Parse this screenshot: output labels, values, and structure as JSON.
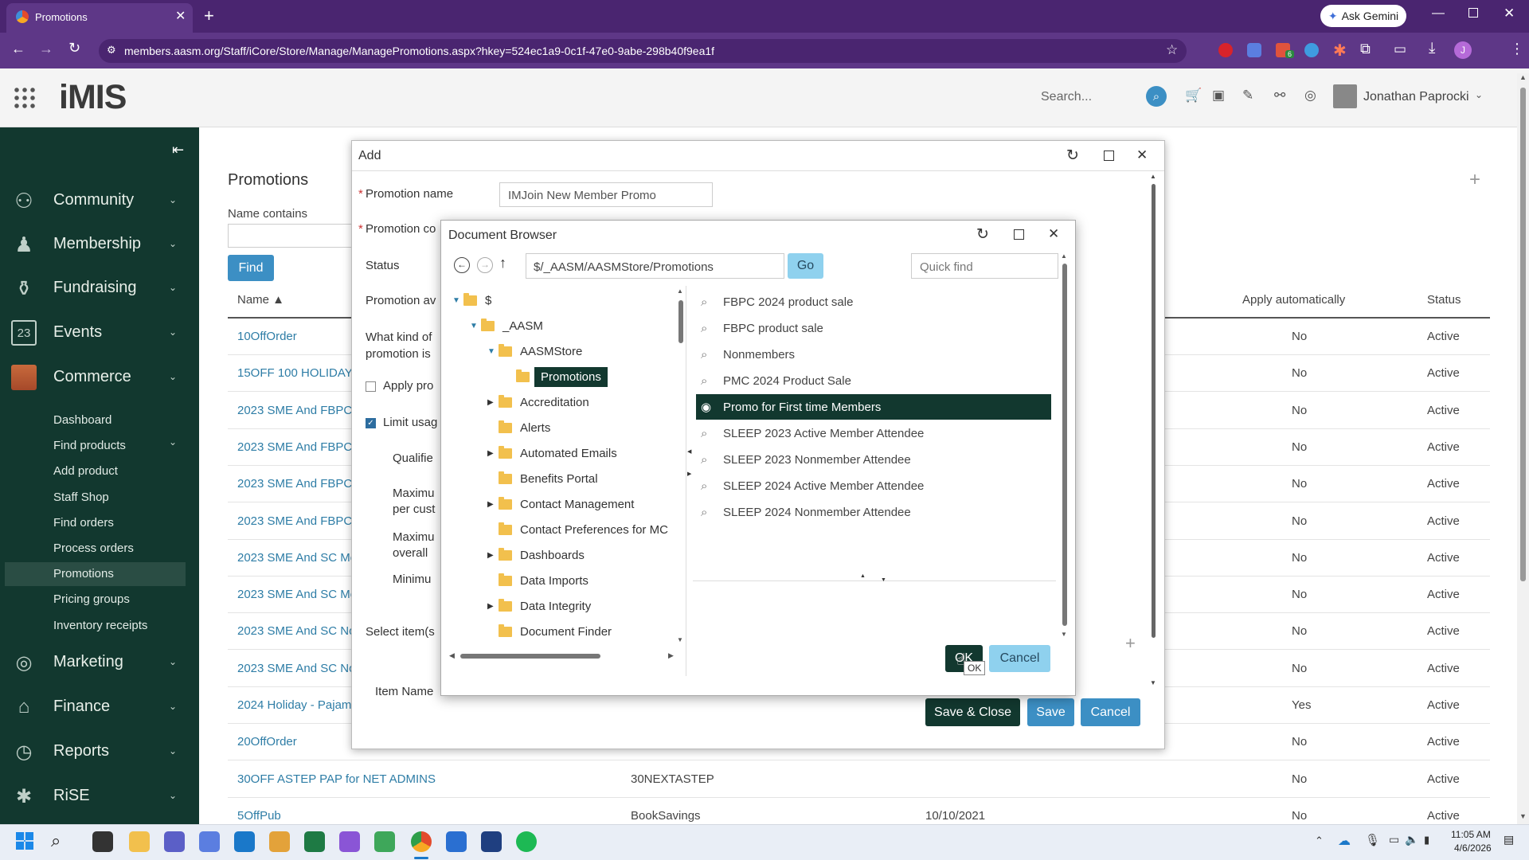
{
  "browser": {
    "tab_title": "Promotions",
    "url": "members.aasm.org/Staff/iCore/Store/Manage/ManagePromotions.aspx?hkey=524ec1a9-0c1f-47e0-9abe-298b40f9ea1f",
    "ask_gemini": "Ask Gemini",
    "extension_badge": "6",
    "profile_initial": "J"
  },
  "app": {
    "logo": "iMIS",
    "search_placeholder": "Search...",
    "user_name": "Jonathan Paprocki"
  },
  "sidebar": {
    "main_items": [
      {
        "label": "Community",
        "icon": "community-icon"
      },
      {
        "label": "Membership",
        "icon": "membership-icon"
      },
      {
        "label": "Fundraising",
        "icon": "fundraising-icon"
      },
      {
        "label": "Events",
        "icon": "calendar-icon",
        "day": "23"
      },
      {
        "label": "Commerce",
        "icon": "commerce-icon"
      }
    ],
    "commerce_sub": [
      "Dashboard",
      "Find products",
      "Add product",
      "Staff Shop",
      "Find orders",
      "Process orders",
      "Promotions",
      "Pricing groups",
      "Inventory receipts"
    ],
    "active_sub": "Promotions",
    "lower_items": [
      {
        "label": "Marketing",
        "icon": "marketing-icon"
      },
      {
        "label": "Finance",
        "icon": "finance-icon"
      },
      {
        "label": "Reports",
        "icon": "reports-icon"
      },
      {
        "label": "RiSE",
        "icon": "rise-icon"
      }
    ]
  },
  "page": {
    "title": "Promotions",
    "filter_label": "Name contains",
    "find_button": "Find",
    "columns": {
      "name": "Name ▲",
      "apply": "Apply automatically",
      "status": "Status"
    },
    "rows": [
      {
        "name": "10OffOrder",
        "code": "",
        "date": "",
        "apply": "No",
        "status": "Active"
      },
      {
        "name": "15OFF 100 HOLIDAY",
        "code": "",
        "date": "",
        "apply": "No",
        "status": "Active"
      },
      {
        "name": "2023 SME And FBPC",
        "code": "",
        "date": "",
        "apply": "No",
        "status": "Active"
      },
      {
        "name": "2023 SME And FBPC",
        "code": "",
        "date": "",
        "apply": "No",
        "status": "Active"
      },
      {
        "name": "2023 SME And FBPC",
        "code": "",
        "date": "",
        "apply": "No",
        "status": "Active"
      },
      {
        "name": "2023 SME And FBPC",
        "code": "",
        "date": "",
        "apply": "No",
        "status": "Active"
      },
      {
        "name": "2023 SME And SC Me",
        "code": "",
        "date": "",
        "apply": "No",
        "status": "Active"
      },
      {
        "name": "2023 SME And SC Me",
        "code": "",
        "date": "",
        "apply": "No",
        "status": "Active"
      },
      {
        "name": "2023 SME And SC No",
        "code": "",
        "date": "",
        "apply": "No",
        "status": "Active"
      },
      {
        "name": "2023 SME And SC No",
        "code": "",
        "date": "",
        "apply": "No",
        "status": "Active"
      },
      {
        "name": "2024 Holiday - Pajam",
        "code": "",
        "date": "",
        "apply": "Yes",
        "status": "Active"
      },
      {
        "name": "20OffOrder",
        "code": "",
        "date": "",
        "apply": "No",
        "status": "Active"
      },
      {
        "name": "30OFF ASTEP PAP for NET ADMINS",
        "code": "30NEXTASTEP",
        "date": "",
        "apply": "No",
        "status": "Active"
      },
      {
        "name": "5OffPub",
        "code": "BookSavings",
        "date": "10/10/2021",
        "apply": "No",
        "status": "Active"
      }
    ]
  },
  "add_modal": {
    "title": "Add",
    "promotion_name_label": "Promotion name",
    "promotion_name_value": "IMJoin New Member Promo",
    "promotion_code_label": "Promotion co",
    "status_label": "Status",
    "promotion_av_label": "Promotion av",
    "what_kind_label": "What kind of promotion is",
    "apply_label": "Apply pro",
    "limit_label": "Limit usag",
    "qualified_label": "Qualifie",
    "max_per_cust_label": "Maximu per cust",
    "max_overall_label": "Maximu overall",
    "minimum_label": "Minimu",
    "select_items_label": "Select item(s",
    "item_name_label": "Item Name",
    "save_close": "Save & Close",
    "save": "Save",
    "cancel": "Cancel"
  },
  "doc_browser": {
    "title": "Document Browser",
    "path": "$/_AASM/AASMStore/Promotions",
    "go": "Go",
    "quick_find_placeholder": "Quick find",
    "tree": [
      {
        "label": "$",
        "level": 0,
        "expander": "open",
        "root": true
      },
      {
        "label": "_AASM",
        "level": 1,
        "expander": "open"
      },
      {
        "label": "AASMStore",
        "level": 2,
        "expander": "open"
      },
      {
        "label": "Promotions",
        "level": 3,
        "expander": "none",
        "selected": true
      },
      {
        "label": "Accreditation",
        "level": 2,
        "expander": "closed"
      },
      {
        "label": "Alerts",
        "level": 2,
        "expander": "none"
      },
      {
        "label": "Automated Emails",
        "level": 2,
        "expander": "closed"
      },
      {
        "label": "Benefits Portal",
        "level": 2,
        "expander": "none"
      },
      {
        "label": "Contact Management",
        "level": 2,
        "expander": "closed"
      },
      {
        "label": "Contact Preferences for MC",
        "level": 2,
        "expander": "none"
      },
      {
        "label": "Dashboards",
        "level": 2,
        "expander": "closed"
      },
      {
        "label": "Data Imports",
        "level": 2,
        "expander": "none"
      },
      {
        "label": "Data Integrity",
        "level": 2,
        "expander": "closed"
      },
      {
        "label": "Document Finder",
        "level": 2,
        "expander": "none"
      }
    ],
    "documents": [
      "FBPC 2024 product sale",
      "FBPC product sale",
      "Nonmembers",
      "PMC 2024 Product Sale",
      "Promo for First time Members",
      "SLEEP 2023 Active Member Attendee",
      "SLEEP 2023 Nonmember Attendee",
      "SLEEP 2024 Active Member Attendee",
      "SLEEP 2024 Nonmember Attendee"
    ],
    "selected_document": "Promo for First time Members",
    "ok": "OK",
    "ok_tooltip": "OK",
    "cancel": "Cancel"
  },
  "taskbar": {
    "time": "11:05 AM",
    "date": "4/6/2026"
  },
  "colors": {
    "chrome_dark": "#4a2570",
    "chrome": "#5e3787",
    "sidebar": "#12382f",
    "accent_blue": "#3c8fc4",
    "link": "#2e7da6",
    "selected_row": "#12382f"
  }
}
